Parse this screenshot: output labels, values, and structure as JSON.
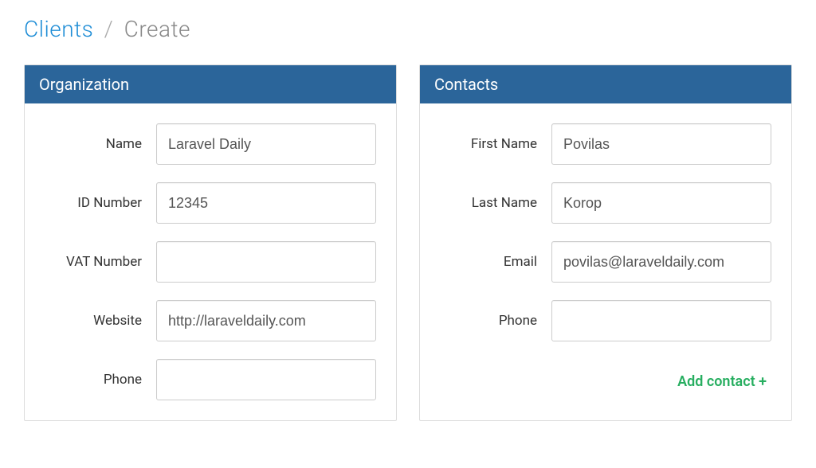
{
  "breadcrumb": {
    "link": "Clients",
    "current": "Create"
  },
  "organization": {
    "title": "Organization",
    "fields": {
      "name_label": "Name",
      "name_value": "Laravel Daily",
      "id_label": "ID Number",
      "id_value": "12345",
      "vat_label": "VAT Number",
      "vat_value": "",
      "website_label": "Website",
      "website_value": "http://laraveldaily.com",
      "phone_label": "Phone",
      "phone_value": ""
    }
  },
  "contacts": {
    "title": "Contacts",
    "fields": {
      "first_name_label": "First Name",
      "first_name_value": "Povilas",
      "last_name_label": "Last Name",
      "last_name_value": "Korop",
      "email_label": "Email",
      "email_value": "povilas@laraveldaily.com",
      "phone_label": "Phone",
      "phone_value": ""
    },
    "add_label": "Add contact +"
  }
}
